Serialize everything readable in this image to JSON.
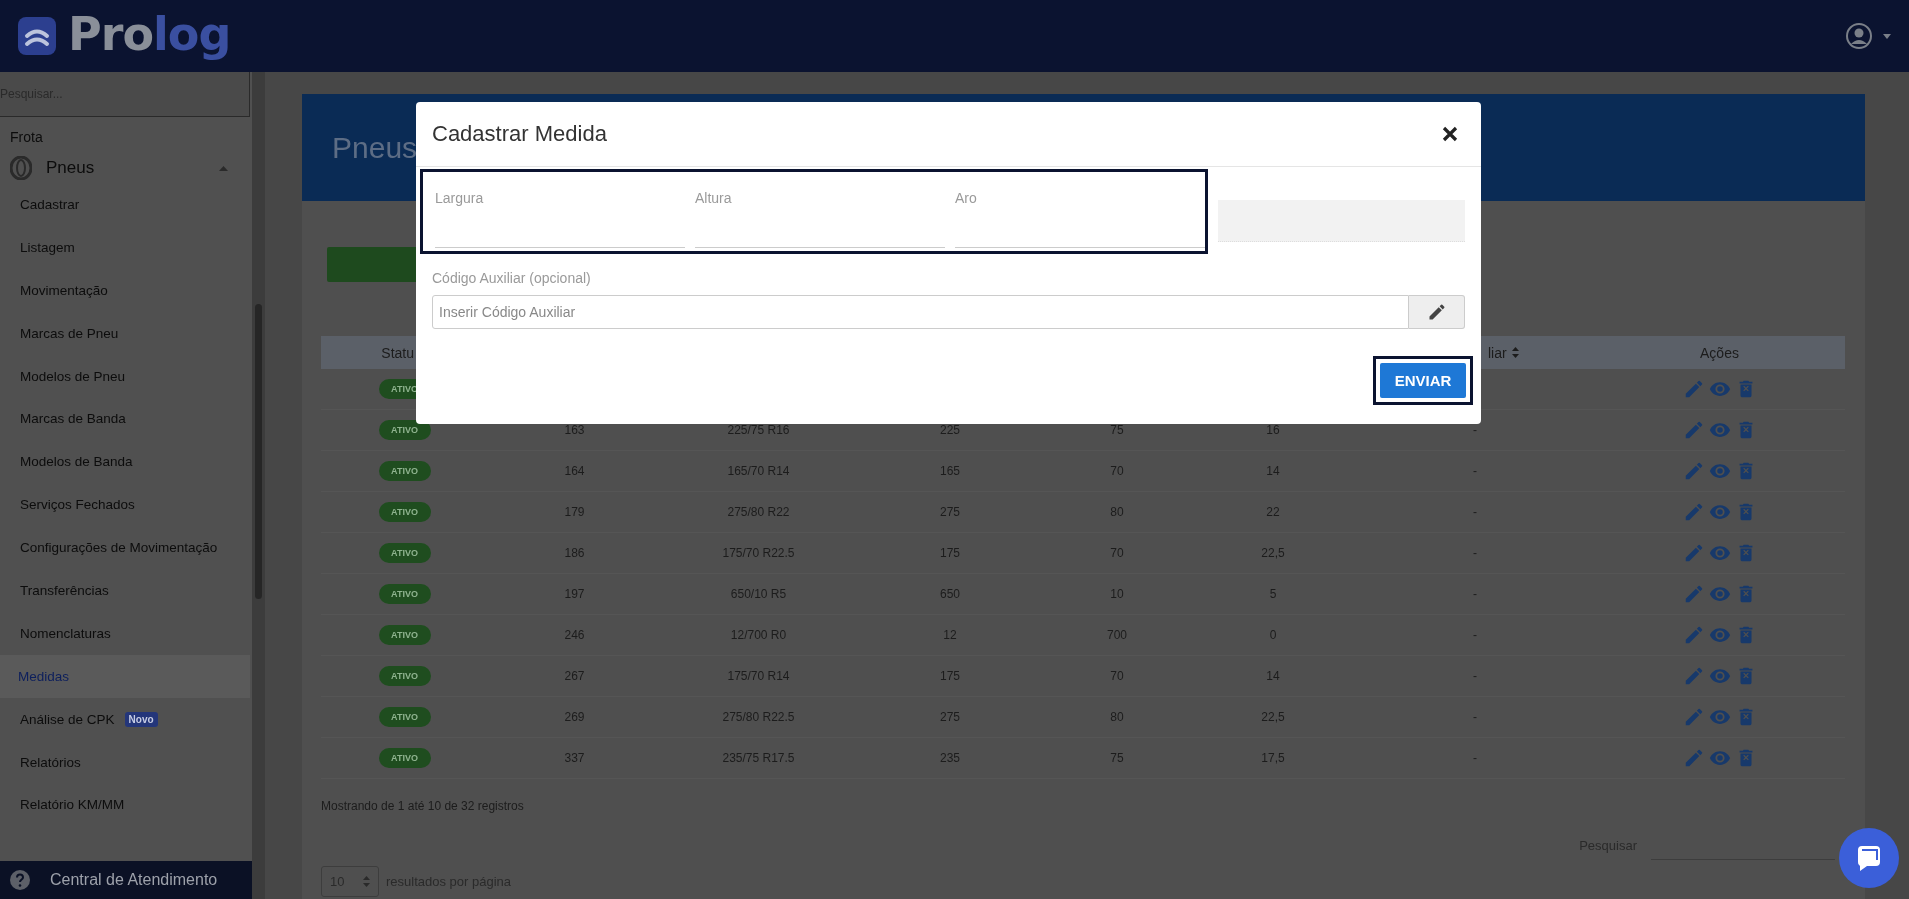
{
  "header": {
    "logo": [
      "Pro",
      "log"
    ]
  },
  "sidebar": {
    "search": {
      "placeholder": "Pesquisar..."
    },
    "section": "Frota",
    "group": {
      "label": "Pneus",
      "expanded": true,
      "items": [
        {
          "label": "Cadastrar",
          "selected": false
        },
        {
          "label": "Listagem",
          "selected": false
        },
        {
          "label": "Movimentação",
          "selected": false
        },
        {
          "label": "Marcas de Pneu",
          "selected": false
        },
        {
          "label": "Modelos de Pneu",
          "selected": false
        },
        {
          "label": "Marcas de Banda",
          "selected": false
        },
        {
          "label": "Modelos de Banda",
          "selected": false
        },
        {
          "label": "Serviços Fechados",
          "selected": false
        },
        {
          "label": "Configurações de Movimentação",
          "selected": false
        },
        {
          "label": "Transferências",
          "selected": false
        },
        {
          "label": "Nomenclaturas",
          "selected": false
        },
        {
          "label": "Medidas",
          "selected": true
        },
        {
          "label": "Análise de CPK",
          "selected": false,
          "badge": "Novo"
        },
        {
          "label": "Relatórios",
          "selected": false
        },
        {
          "label": "Relatório KM/MM",
          "selected": false
        }
      ]
    },
    "help": "Central de Atendimento"
  },
  "page": {
    "title": "Pneus"
  },
  "table": {
    "columns": [
      {
        "label": "Statu"
      },
      {},
      {},
      {},
      {},
      {},
      {
        "label": "liar",
        "sortable": true
      },
      {
        "label": "Ações"
      }
    ],
    "rows": [
      {
        "status": "ATIVO"
      },
      {
        "status": "ATIVO",
        "id": "163",
        "medida": "225/75 R16",
        "largura": "225",
        "altura": "75",
        "aro": "16",
        "aux": "-"
      },
      {
        "status": "ATIVO",
        "id": "164",
        "medida": "165/70 R14",
        "largura": "165",
        "altura": "70",
        "aro": "14",
        "aux": "-"
      },
      {
        "status": "ATIVO",
        "id": "179",
        "medida": "275/80 R22",
        "largura": "275",
        "altura": "80",
        "aro": "22",
        "aux": "-"
      },
      {
        "status": "ATIVO",
        "id": "186",
        "medida": "175/70 R22.5",
        "largura": "175",
        "altura": "70",
        "aro": "22,5",
        "aux": "-"
      },
      {
        "status": "ATIVO",
        "id": "197",
        "medida": "650/10 R5",
        "largura": "650",
        "altura": "10",
        "aro": "5",
        "aux": "-"
      },
      {
        "status": "ATIVO",
        "id": "246",
        "medida": "12/700 R0",
        "largura": "12",
        "altura": "700",
        "aro": "0",
        "aux": "-"
      },
      {
        "status": "ATIVO",
        "id": "267",
        "medida": "175/70 R14",
        "largura": "175",
        "altura": "70",
        "aro": "14",
        "aux": "-"
      },
      {
        "status": "ATIVO",
        "id": "269",
        "medida": "275/80 R22.5",
        "largura": "275",
        "altura": "80",
        "aro": "22,5",
        "aux": "-"
      },
      {
        "status": "ATIVO",
        "id": "337",
        "medida": "235/75 R17.5",
        "largura": "235",
        "altura": "75",
        "aro": "17,5",
        "aux": "-"
      }
    ]
  },
  "table_footer": {
    "info": "Mostrando de 1 até 10 de 32 registros",
    "search_label": "Pesquisar",
    "page_size": "10",
    "page_size_label": "resultados por página"
  },
  "modal": {
    "title": "Cadastrar Medida",
    "fields": [
      {
        "kind": "text",
        "label": "Largura",
        "highlighted": true
      },
      {
        "kind": "text",
        "label": "Altura",
        "highlighted": true
      },
      {
        "kind": "text",
        "label": "Aro",
        "highlighted": true
      },
      {
        "kind": "readonly",
        "highlighted": false
      }
    ],
    "aux": {
      "label": "Código Auxiliar (opcional)",
      "placeholder": "Inserir Código Auxiliar"
    },
    "submit": {
      "label": "ENVIAR",
      "highlighted": true
    }
  }
}
